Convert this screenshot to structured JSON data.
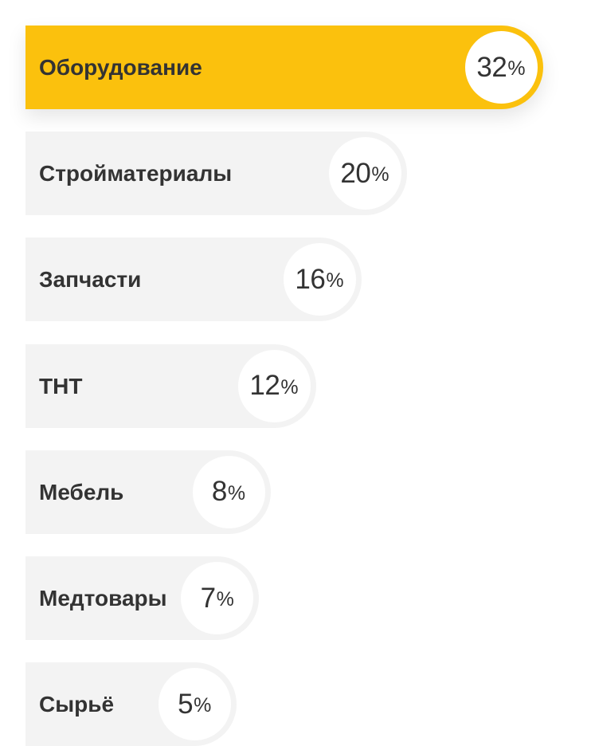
{
  "chart_data": {
    "type": "bar",
    "orientation": "horizontal",
    "categories": [
      "Оборудование",
      "Стройматериалы",
      "Запчасти",
      "ТНТ",
      "Мебель",
      "Медтовары",
      "Сырьё"
    ],
    "values": [
      32,
      20,
      16,
      12,
      8,
      7,
      5
    ],
    "value_suffix": "%",
    "highlighted_index": 0,
    "title": "",
    "xlabel": "",
    "ylabel": ""
  },
  "colors": {
    "highlight": "#fbc10d",
    "bar": "#f3f3f3",
    "badge": "#ffffff",
    "text": "#333333"
  }
}
